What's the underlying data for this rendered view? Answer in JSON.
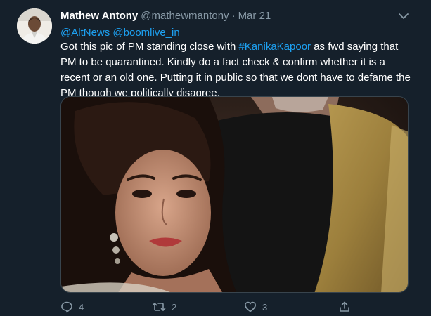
{
  "tweet": {
    "author_name": "Mathew Antony",
    "author_handle": "@mathewmantony",
    "separator": "·",
    "date": "Mar 21",
    "reply_mentions": [
      "@AltNews",
      "@boomlive_in"
    ],
    "text_before_hashtag": "Got this pic of PM standing close with ",
    "hashtag": "#KanikaKapoor",
    "text_after_hashtag": " as fwd saying that PM to be quarantined. Kindly do a fact check & confirm whether it is a recent or an old one. Putting it in public so that we dont have to defame the PM though we politically disagree.",
    "photo_icon": "tweet-photo",
    "menu_icon": "chevron-down-icon"
  },
  "actions": {
    "reply": {
      "icon": "reply-icon",
      "count": "4"
    },
    "retweet": {
      "icon": "retweet-icon",
      "count": "2"
    },
    "like": {
      "icon": "heart-icon",
      "count": "3"
    },
    "share": {
      "icon": "share-icon"
    }
  },
  "colors": {
    "background": "#15202b",
    "text": "#ffffff",
    "muted": "#8899a6",
    "accent": "#1da1f2"
  }
}
